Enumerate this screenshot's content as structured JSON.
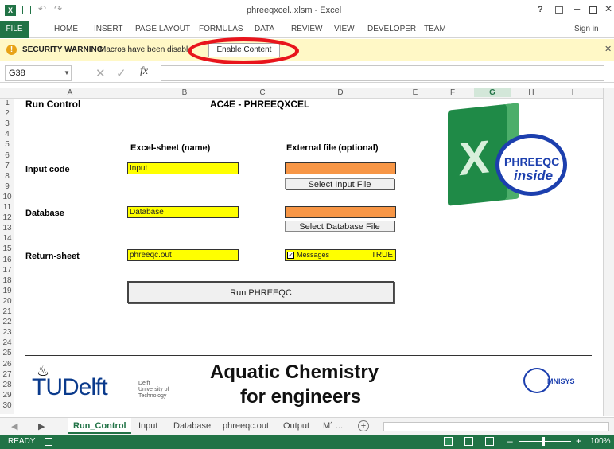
{
  "window": {
    "title": "phreeqxcel..xlsm - Excel",
    "help": "?",
    "sign_in": "Sign in"
  },
  "ribbon": {
    "tabs": [
      "FILE",
      "HOME",
      "INSERT",
      "PAGE LAYOUT",
      "FORMULAS",
      "DATA",
      "REVIEW",
      "VIEW",
      "DEVELOPER",
      "TEAM"
    ]
  },
  "security": {
    "label": "SECURITY WARNING",
    "message": "Macros have been disabl",
    "button": "Enable Content"
  },
  "formula": {
    "cell_ref": "G38",
    "fx": "fx",
    "value": ""
  },
  "columns": [
    "A",
    "B",
    "C",
    "D",
    "E",
    "F",
    "G",
    "H",
    "I"
  ],
  "rows": [
    "1",
    "2",
    "3",
    "4",
    "5",
    "6",
    "7",
    "8",
    "9",
    "10",
    "11",
    "12",
    "13",
    "14",
    "15",
    "16",
    "17",
    "18",
    "19",
    "20",
    "21",
    "22",
    "23",
    "24",
    "25",
    "26",
    "27",
    "28",
    "29",
    "30"
  ],
  "sheet": {
    "run_control": "Run Control",
    "title": "AC4E - PHREEQXCEL",
    "col_excel": "Excel-sheet (name)",
    "col_external": "External file (optional)",
    "input_code_label": "Input code",
    "input_code_value": "Input",
    "select_input_button": "Select Input File",
    "database_label": "Database",
    "database_value": "Database",
    "select_database_button": "Select Database File",
    "return_label": "Return-sheet",
    "return_value": "phreeqc.out",
    "messages_label": "Messages",
    "messages_value": "TRUE",
    "run_button": "Run PHREEQC"
  },
  "logo": {
    "phreeqc": "PHREEQC",
    "inside": "inside"
  },
  "footer": {
    "tudelft": "TUDelft",
    "tudelft_sub1": "Delft",
    "tudelft_sub2": "University of",
    "tudelft_sub3": "Technology",
    "heading1": "Aquatic Chemistry",
    "heading2": "for engineers",
    "omnisys": "MNISYS"
  },
  "sheet_tabs": [
    "Run_Control",
    "Input",
    "Database",
    "phreeqc.out",
    "Output",
    "M´ ..."
  ],
  "status": {
    "ready": "READY",
    "zoom": "100%"
  }
}
